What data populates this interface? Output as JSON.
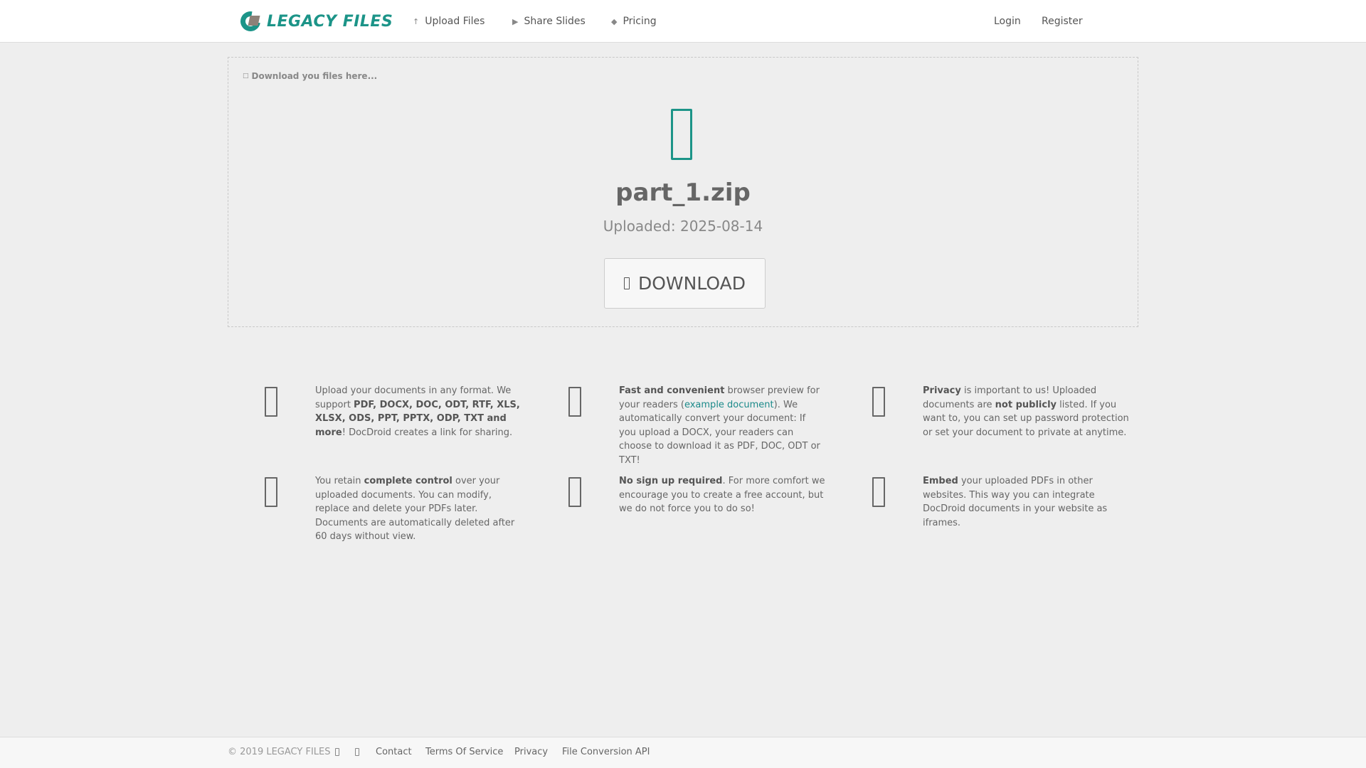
{
  "brand": {
    "name": "LEGACY FILES",
    "colors": {
      "accent": "#1c9488",
      "logo_square": "#8d8178",
      "link": "#1c8a8a"
    }
  },
  "nav": {
    "upload": {
      "label": "Upload Files",
      "icon": "upload-icon"
    },
    "share": {
      "label": "Share Slides",
      "icon": "share-icon"
    },
    "pricing": {
      "label": "Pricing",
      "icon": "tag-icon"
    },
    "login": "Login",
    "register": "Register"
  },
  "download_box": {
    "hint": "Download you files here...",
    "file_icon": "file-archive-icon",
    "file_name": "part_1.zip",
    "uploaded": "Uploaded: 2025-08-14",
    "button_label": "DOWNLOAD",
    "button_icon": "download-file-icon"
  },
  "features": [
    {
      "icon": "file-icon",
      "parts": [
        "Upload your documents in any format. We support ",
        "PDF, DOCX, DOC, ODT, RTF, XLS, XLSX, ODS, PPT, PPTX, ODP, TXT and more",
        "! DocDroid creates a link for sharing."
      ]
    },
    {
      "icon": "file-preview-icon",
      "parts": [
        "Fast and convenient",
        " browser preview for your readers (",
        "example document",
        "). We automatically convert your document: If you upload a DOCX, your readers can choose to download it as PDF, DOC, ODT or TXT!"
      ]
    },
    {
      "icon": "lock-icon",
      "parts": [
        "Privacy",
        " is important to us! Uploaded documents are ",
        "not publicly",
        " listed. If you want to, you can set up password protection or set your document to private at anytime."
      ]
    },
    {
      "icon": "control-icon",
      "parts": [
        "You retain ",
        "complete control",
        " over your uploaded documents. You can modify, replace and delete your PDFs later. Documents are automatically deleted after 60 days without view."
      ]
    },
    {
      "icon": "user-icon",
      "parts": [
        "No sign up required",
        ". For more comfort we encourage you to create a free account, but we do not force you to do so!"
      ]
    },
    {
      "icon": "embed-icon",
      "parts": [
        "Embed",
        " your uploaded PDFs in other websites. This way you can integrate DocDroid documents in your website as iframes."
      ]
    }
  ],
  "footer": {
    "copyright": "© 2019 LEGACY FILES",
    "social_icons": [
      "facebook-icon",
      "twitter-icon"
    ],
    "links": [
      "Contact",
      "Terms Of Service",
      "Privacy",
      "File Conversion API"
    ]
  }
}
